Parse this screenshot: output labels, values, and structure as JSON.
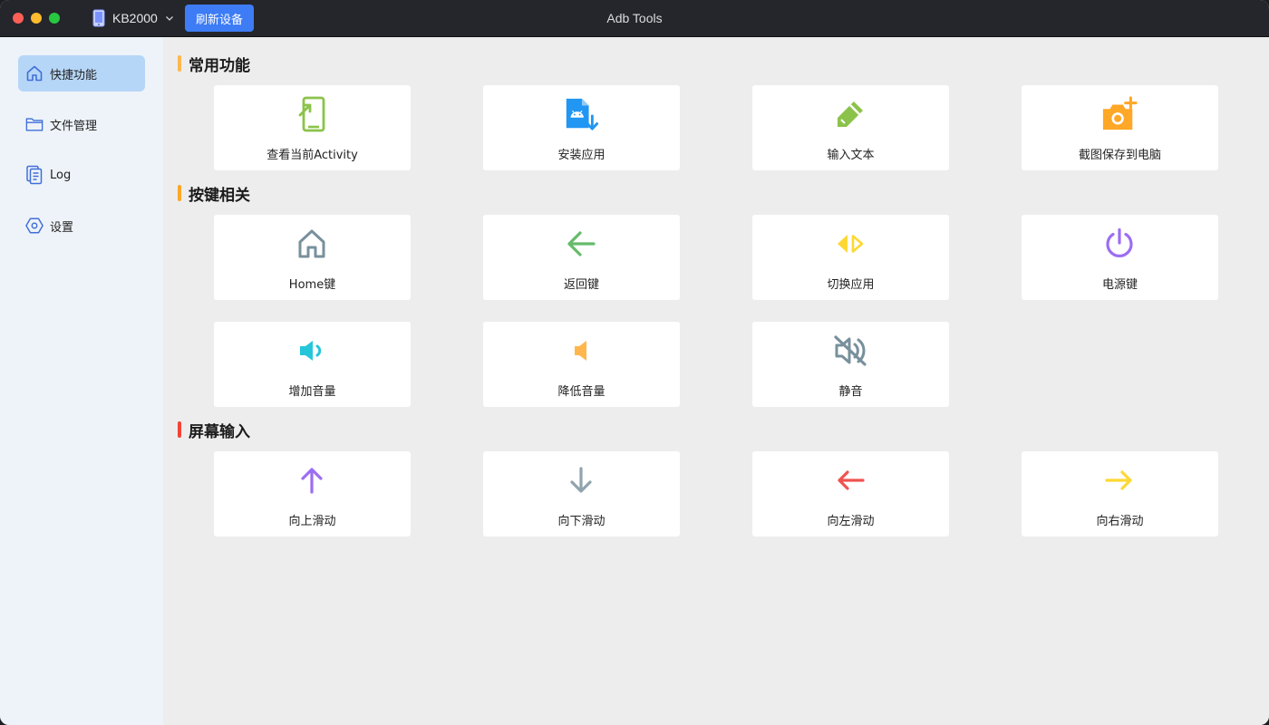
{
  "window": {
    "title": "Adb Tools"
  },
  "toolbar": {
    "device_name": "KB2000",
    "refresh_label": "刷新设备"
  },
  "sidebar": {
    "items": [
      {
        "label": "快捷功能",
        "icon": "home-icon",
        "active": true
      },
      {
        "label": "文件管理",
        "icon": "folder-icon",
        "active": false
      },
      {
        "label": "Log",
        "icon": "log-icon",
        "active": false
      },
      {
        "label": "设置",
        "icon": "settings-icon",
        "active": false
      }
    ]
  },
  "sections": [
    {
      "title": "常用功能",
      "accent": "#ffb74d",
      "cards": [
        {
          "label": "查看当前Activity",
          "icon": "activity-phone-icon",
          "color": "#8bc34a"
        },
        {
          "label": "安装应用",
          "icon": "android-install-icon",
          "color": "#2196f3"
        },
        {
          "label": "输入文本",
          "icon": "pen-icon",
          "color": "#8bc34a"
        },
        {
          "label": "截图保存到电脑",
          "icon": "camera-add-icon",
          "color": "#ffa726"
        }
      ]
    },
    {
      "title": "按键相关",
      "accent": "#ffa726",
      "cards": [
        {
          "label": "Home键",
          "icon": "home-key-icon",
          "color": "#78909c"
        },
        {
          "label": "返回键",
          "icon": "arrow-left-icon",
          "color": "#66bb6a"
        },
        {
          "label": "切换应用",
          "icon": "switch-app-icon",
          "color": "#fdd835"
        },
        {
          "label": "电源键",
          "icon": "power-icon",
          "color": "#9c6ef2"
        },
        {
          "label": "增加音量",
          "icon": "volume-up-icon",
          "color": "#26c6da"
        },
        {
          "label": "降低音量",
          "icon": "volume-down-icon",
          "color": "#ffb74d"
        },
        {
          "label": "静音",
          "icon": "mute-icon",
          "color": "#78909c"
        }
      ]
    },
    {
      "title": "屏幕输入",
      "accent": "#f44336",
      "cards": [
        {
          "label": "向上滑动",
          "icon": "arrow-up-icon",
          "color": "#9c6ef2"
        },
        {
          "label": "向下滑动",
          "icon": "arrow-down-icon",
          "color": "#90a4ae"
        },
        {
          "label": "向左滑动",
          "icon": "arrow-left-icon",
          "color": "#ef5350"
        },
        {
          "label": "向右滑动",
          "icon": "arrow-right-icon",
          "color": "#fdd835"
        }
      ]
    }
  ]
}
